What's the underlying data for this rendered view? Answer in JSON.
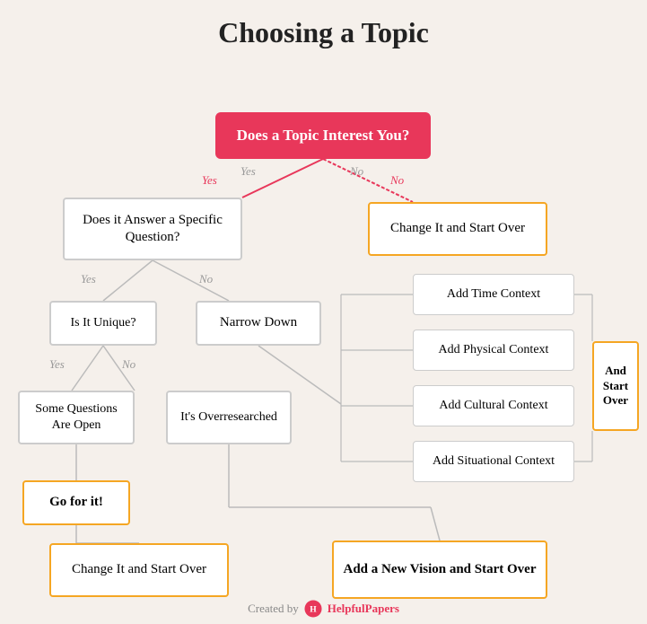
{
  "title": "Choosing a Topic",
  "boxes": {
    "start": "Does a Topic Interest You?",
    "question": "Does it Answer a Specific Question?",
    "change_top": "Change It and Start Over",
    "unique": "Is It Unique?",
    "narrow": "Narrow Down",
    "some_questions": "Some Questions Are Open",
    "overresearched": "It's Overresearched",
    "goforit": "Go for it!",
    "change_bottom": "Change It and Start Over",
    "new_vision": "Add a New Vision and Start Over",
    "time_context": "Add Time Context",
    "physical_context": "Add Physical Context",
    "cultural_context": "Add Cultural Context",
    "situational_context": "Add Situational Context",
    "and_start_over": "And Start Over"
  },
  "labels": {
    "yes1": "Yes",
    "no1": "No",
    "yes2": "Yes",
    "no2": "No",
    "yes3": "Yes",
    "no3": "No"
  },
  "footer": {
    "created_by": "Created by",
    "brand": "HelpfulPapers"
  }
}
